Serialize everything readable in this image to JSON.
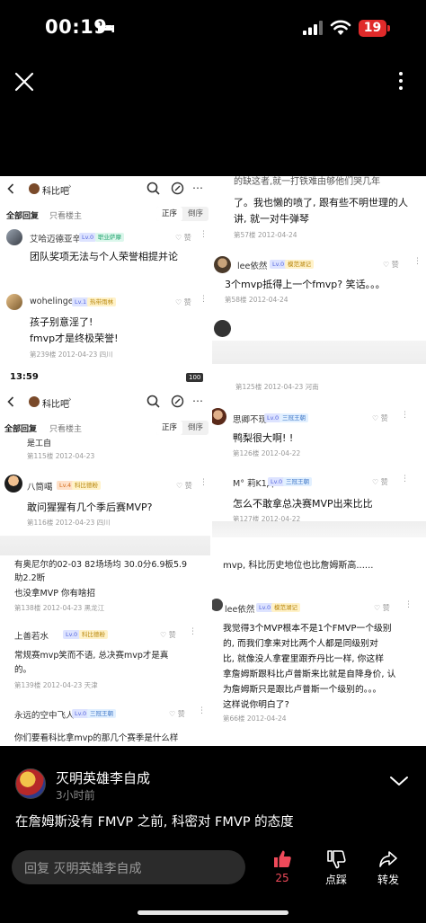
{
  "status_bar": {
    "time": "00:19",
    "battery": "19"
  },
  "collage": {
    "top_left": {
      "nav_title": "科比吧",
      "tab_all": "全部回复",
      "tab_owner": "只看楼主",
      "sort_asc": "正序",
      "sort_desc": "倒序",
      "c1": {
        "user": "艾哈迈德亚辛",
        "level": "Lv.0",
        "badge": "职业萨摩",
        "text": "团队奖项无法与个人荣誉相提并论",
        "like": "赞"
      },
      "c2": {
        "user": "wohelinger",
        "level": "Lv.1",
        "badge": "热带雨林",
        "line1": "孩子别意淫了!",
        "line2": "fmvp才是终极荣誉!",
        "meta": "第239楼  2012-04-23  四川",
        "like": "赞"
      }
    },
    "bottom_left": {
      "time": "13:59",
      "battery": "100",
      "nav_title": "科比吧",
      "tab_all": "全部回复",
      "tab_owner": "只看楼主",
      "sort_asc": "正序",
      "sort_desc": "倒序",
      "cut_text": "是工自",
      "cut_meta": "第115楼  2012-04-23",
      "c1": {
        "user": "八筒噶",
        "level": "Lv.4",
        "badge": "科比德粉",
        "text": "敢问猩猩有几个季后赛MVP?",
        "meta": "第116楼  2012-04-23  四川",
        "like": "赞"
      },
      "c2": {
        "line1": "有奥尼尔的02-03 82场场均 30.0分6.9板5.9",
        "line2": "助2.2断",
        "line3": "也没拿MVP 你有啥招",
        "meta": "第138楼  2012-04-23  黑龙江"
      },
      "c3": {
        "user": "上善若水",
        "level": "Lv.0",
        "badge": "科比德粉",
        "line1": "常规赛mvp笑而不语, 总决赛mvp才是真",
        "line2": "的。",
        "meta": "第139楼  2012-04-23  天津",
        "like": "赞"
      },
      "c4": {
        "user": "永远的空中飞人",
        "level": "Lv.0",
        "badge": "三冠王朝",
        "text": "你们要看科比拿mvp的那几个赛季是什么样",
        "like": "赞"
      }
    },
    "top_right": {
      "c0": {
        "line1": "的缺这者,就一打铁难由够他们哭几年",
        "line2": "了。我也懒的喷了, 跟有些不明世理的人",
        "line3": "讲, 就一对牛弹琴",
        "meta": "第57楼  2012-04-24"
      },
      "c1": {
        "user": "lee依然",
        "level": "Lv.0",
        "badge": "模范湖记",
        "text": "3个mvp抵得上一个fmvp? 笑话。。。",
        "meta": "第58楼  2012-04-24",
        "like": "赞"
      },
      "c2": {
        "meta": "第125楼  2012-04-23  河南"
      },
      "c3": {
        "user": "思卿不现",
        "level": "Lv.0",
        "badge": "三冠王朝",
        "text": "鸭梨很大啊! !",
        "meta": "第126楼  2012-04-22",
        "like": "赞"
      },
      "c4": {
        "user": "M° 莉K1Д",
        "level": "Lv.0",
        "badge": "三冠王朝",
        "text": "怎么不敢拿总决赛MVP出来比比",
        "meta": "第127楼  2012-04-22",
        "like": "赞"
      }
    },
    "bottom_right": {
      "cut_text": "mvp, 科比历史地位也比詹姆斯高......",
      "c1": {
        "user": "lee依然",
        "level": "Lv.0",
        "badge": "模范湖记",
        "lines": [
          "我觉得3个MVP根本不是1个FMVP一个级别",
          "的, 而我们拿来对比两个人都是同级别对",
          "比, 就像没人拿霍里跟乔丹比一样, 你这样",
          "拿詹姆斯跟科比卢普斯来比就是自降身价, 认",
          "为詹姆斯只是跟比卢普斯一个级别的。。。",
          "这样说你明白了?"
        ],
        "meta": "第66楼  2012-04-24",
        "like": "赞"
      }
    }
  },
  "post": {
    "author": "灭明英雄李自成",
    "time": "3小时前",
    "title": "在詹姆斯没有 FMVP 之前, 科密对 FMVP 的态度"
  },
  "actions": {
    "reply_placeholder": "回复 灭明英雄李自成",
    "like_count": "25",
    "dislike_label": "点踩",
    "share_label": "转发"
  },
  "colors": {
    "accent_like": "#ef4a5a",
    "battery_red": "#e02a2a"
  }
}
